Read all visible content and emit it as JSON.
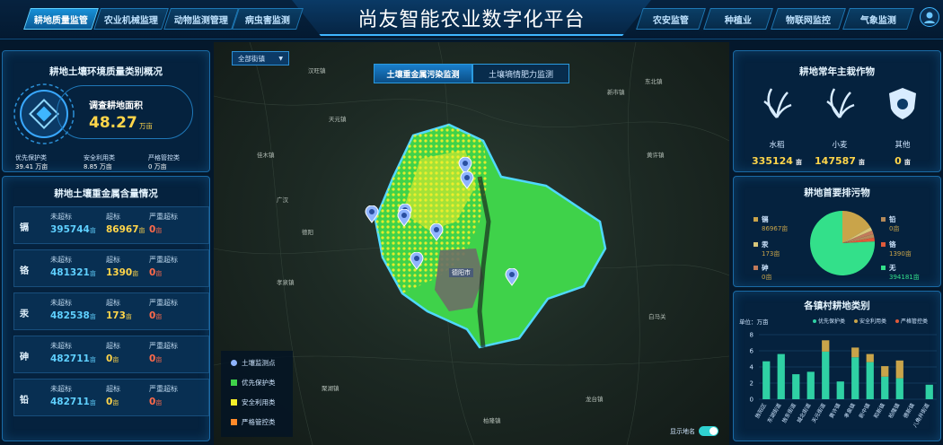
{
  "header": {
    "title": "尚友智能农业数字化平台",
    "left_tabs": [
      "耕地质量监管",
      "农业机械监理",
      "动物监测管理",
      "病虫害监测"
    ],
    "right_tabs": [
      "农安监管",
      "种植业",
      "物联网监控",
      "气象监测"
    ],
    "active_tab": "耕地质量监管"
  },
  "left": {
    "overview_title": "耕地土壤环境质量类别概况",
    "area_label": "调查耕地面积",
    "area_value": "48.27",
    "area_unit": "万亩",
    "categories": [
      {
        "label": "优先保护类",
        "value": "39.41 万亩"
      },
      {
        "label": "安全利用类",
        "value": "8.85 万亩"
      },
      {
        "label": "严格管控类",
        "value": "0 万亩"
      }
    ],
    "metals_title": "耕地土壤重金属含量情况",
    "col_labels": [
      "未超标",
      "超标",
      "严重超标"
    ],
    "metals": [
      {
        "name": "镉",
        "ok": "395744",
        "over": "86967",
        "severe": "0"
      },
      {
        "name": "铬",
        "ok": "481321",
        "over": "1390",
        "severe": "0"
      },
      {
        "name": "汞",
        "ok": "482538",
        "over": "173",
        "severe": "0"
      },
      {
        "name": "砷",
        "ok": "482711",
        "over": "0",
        "severe": "0"
      },
      {
        "name": "铅",
        "ok": "482711",
        "over": "0",
        "severe": "0"
      }
    ],
    "unit": "亩"
  },
  "map": {
    "town_select": "全部街镇",
    "btn_metal": "土壤重金属污染监测",
    "btn_fert": "土壤墒情肥力监测",
    "legend": [
      "土壤监测点",
      "优先保护类",
      "安全利用类",
      "严格管控类"
    ],
    "legend_colors": [
      "#8fb4ff",
      "#3fd24a",
      "#f5ef2a",
      "#ff8a2a"
    ],
    "toggle_label": "显示地名",
    "city_label": "德阳市",
    "place_labels": [
      "汉旺镇",
      "佳木镇",
      "天元镇",
      "广汉",
      "德阳",
      "新市镇",
      "黄许镇",
      "白马关",
      "东北镇",
      "聚湖镇",
      "龙台镇",
      "孝泉镇",
      "柏隆镇"
    ]
  },
  "right": {
    "crops_title": "耕地常年主栽作物",
    "crops": [
      {
        "name": "水稻",
        "value": "335124",
        "unit": "亩"
      },
      {
        "name": "小麦",
        "value": "147587",
        "unit": "亩"
      },
      {
        "name": "其他",
        "value": "0",
        "unit": "亩"
      }
    ],
    "pollutant_title": "耕地首要排污物",
    "pollutants": [
      {
        "name": "镉",
        "value": "86967亩",
        "color": "#c9a44a",
        "share": 86967
      },
      {
        "name": "汞",
        "value": "173亩",
        "color": "#d9c77a",
        "share": 173
      },
      {
        "name": "砷",
        "value": "0亩",
        "color": "#c27a5a",
        "share": 0
      },
      {
        "name": "铅",
        "value": "0亩",
        "color": "#b48a5a",
        "share": 0
      },
      {
        "name": "铬",
        "value": "1390亩",
        "color": "#e05a3a",
        "share": 1390
      },
      {
        "name": "无",
        "value": "394181亩",
        "color": "#33e08a",
        "share": 394181
      }
    ],
    "bar_title": "各镇村耕地类别",
    "bar_unit": "单位：万亩",
    "bar_legend": [
      "优先保护类",
      "安全利用类",
      "严格管控类"
    ]
  },
  "chart_data": {
    "type": "bar",
    "stacked": true,
    "categories": [
      "旌阳区",
      "东湖街道",
      "旌东街道",
      "城北街道",
      "天元街道",
      "黄许镇",
      "孝泉镇",
      "新中镇",
      "和新镇",
      "柏隆镇",
      "德新镇",
      "八角井街道"
    ],
    "series": [
      {
        "name": "优先保护类",
        "values": [
          4.7,
          5.6,
          3.1,
          3.4,
          5.9,
          2.2,
          5.2,
          4.6,
          2.8,
          2.6,
          0,
          1.8
        ],
        "color": "#2fd1a4"
      },
      {
        "name": "安全利用类",
        "values": [
          0,
          0,
          0,
          0,
          1.4,
          0,
          1.2,
          1.0,
          1.3,
          2.2,
          0,
          0
        ],
        "color": "#c9a44a"
      },
      {
        "name": "严格管控类",
        "values": [
          0,
          0,
          0,
          0,
          0,
          0,
          0,
          0,
          0,
          0,
          0,
          0
        ],
        "color": "#e05a3a"
      }
    ],
    "ylim": [
      0,
      8
    ],
    "yticks": [
      0,
      2,
      4,
      6,
      8
    ]
  }
}
